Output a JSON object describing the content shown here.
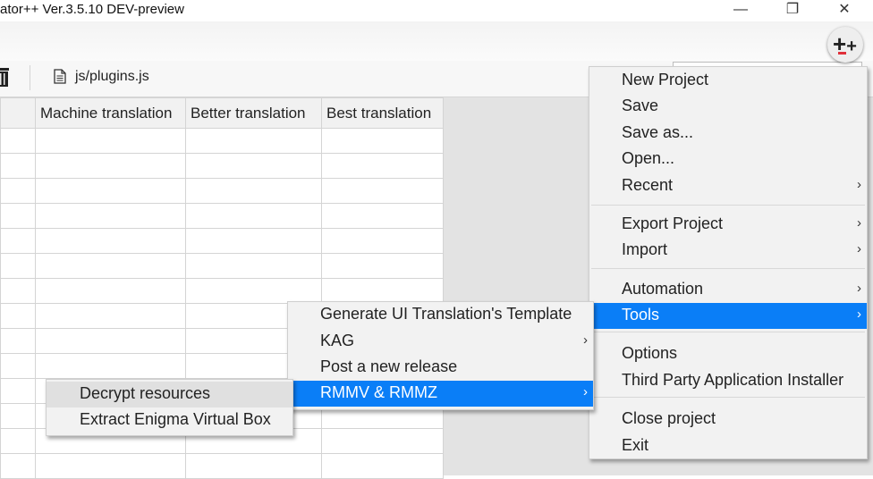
{
  "window": {
    "title": "ator++ Ver.3.5.10 DEV-preview",
    "minimize_glyph": "—",
    "restore_glyph": "❐",
    "close_glyph": "✕"
  },
  "app_badge": {
    "glyph": "+",
    "icon": "translator-plus-logo-icon"
  },
  "tab": {
    "file_label": "js/plugins.js",
    "file_icon": "file-icon",
    "trash_icon": "trash-icon"
  },
  "grid": {
    "columns": [
      "",
      "Machine translation",
      "Better translation",
      "Best translation"
    ],
    "row_count": 14
  },
  "main_menu": {
    "items": [
      {
        "label": "New Project",
        "submenu": false
      },
      {
        "label": "Save",
        "submenu": false
      },
      {
        "label": "Save as...",
        "submenu": false
      },
      {
        "label": "Open...",
        "submenu": false
      },
      {
        "label": "Recent",
        "submenu": true
      },
      {
        "label": "Export Project",
        "submenu": true
      },
      {
        "label": "Import",
        "submenu": true
      },
      {
        "label": "Automation",
        "submenu": true
      },
      {
        "label": "Tools",
        "submenu": true,
        "active": true
      },
      {
        "label": "Options",
        "submenu": false
      },
      {
        "label": "Third Party Application Installer",
        "submenu": false
      },
      {
        "label": "Close project",
        "submenu": false
      },
      {
        "label": "Exit",
        "submenu": false
      }
    ]
  },
  "tools_menu": {
    "items": [
      {
        "label": "Generate UI Translation's Template",
        "submenu": false
      },
      {
        "label": "KAG",
        "submenu": true
      },
      {
        "label": "Post a new release",
        "submenu": false
      },
      {
        "label": "RMMV & RMMZ",
        "submenu": true,
        "active": true
      }
    ]
  },
  "rmmv_menu": {
    "items": [
      {
        "label": "Decrypt resources",
        "submenu": false,
        "hover": true
      },
      {
        "label": "Extract Enigma Virtual Box",
        "submenu": false
      }
    ]
  },
  "arrow_glyph": "›",
  "colors": {
    "accent": "#0a7ef7",
    "menu_bg": "#f2f2f2",
    "grid_bg": "#e3e3e3"
  }
}
